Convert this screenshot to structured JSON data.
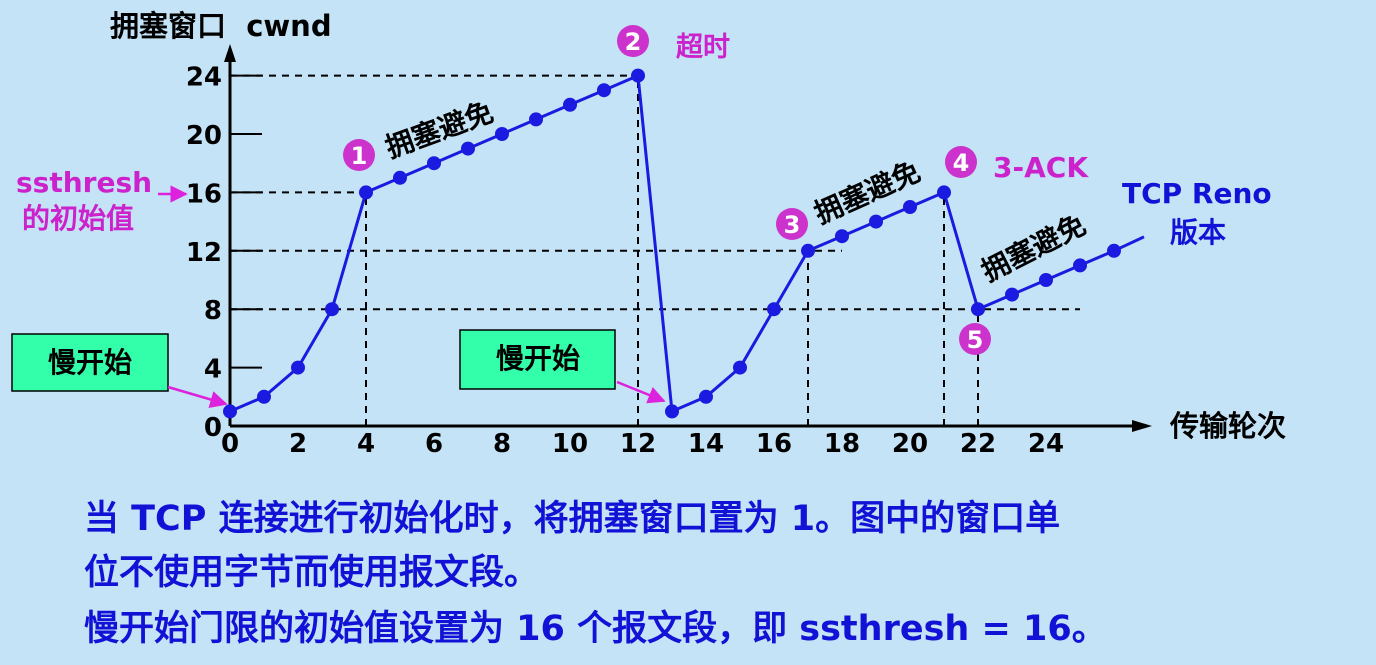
{
  "chart_data": {
    "type": "line",
    "title": "",
    "ylabel": "拥塞窗口  cwnd",
    "xlabel": "传输轮次",
    "x_ticks": [
      0,
      2,
      4,
      6,
      8,
      10,
      12,
      14,
      16,
      18,
      20,
      22,
      24
    ],
    "y_ticks": [
      0,
      4,
      8,
      12,
      16,
      20,
      24
    ],
    "xlim": [
      0,
      27
    ],
    "ylim": [
      0,
      26
    ],
    "series": [
      {
        "name": "",
        "x": [
          0,
          1,
          2,
          3,
          4,
          5,
          6,
          7,
          8,
          9,
          10,
          11,
          12,
          13,
          14,
          15,
          16,
          17,
          18,
          19,
          20,
          21,
          22,
          23,
          24,
          25,
          26
        ],
        "y": [
          1,
          2,
          4,
          8,
          16,
          17,
          18,
          19,
          20,
          21,
          22,
          23,
          24,
          1,
          2,
          4,
          8,
          12,
          13,
          14,
          15,
          16,
          8,
          9,
          10,
          11,
          12
        ]
      }
    ],
    "guide_lines": [
      {
        "axis": "y",
        "value": 24,
        "x_end": 12
      },
      {
        "axis": "y",
        "value": 16,
        "x_end": 4
      },
      {
        "axis": "y",
        "value": 12,
        "x_end": 18
      },
      {
        "axis": "y",
        "value": 8,
        "x_end": 25
      },
      {
        "axis": "x",
        "value": 4,
        "y_top": 16
      },
      {
        "axis": "x",
        "value": 12,
        "y_top": 24
      },
      {
        "axis": "x",
        "value": 17,
        "y_top": 12
      },
      {
        "axis": "x",
        "value": 21,
        "y_top": 16
      },
      {
        "axis": "x",
        "value": 22,
        "y_top": 8
      }
    ],
    "annotations": {
      "slow_start_label": "慢开始",
      "congestion_avoidance_label": "拥塞避免",
      "timeout_label": "超时",
      "three_ack_label": "3-ACK",
      "ssthresh_line1": "ssthresh",
      "ssthresh_line2": "的初始值",
      "version_line1": "TCP Reno",
      "version_line2": "版本",
      "markers": [
        "1",
        "2",
        "3",
        "4",
        "5"
      ]
    },
    "colors": {
      "background": "#c5e3f6",
      "line": "#1a1ae0",
      "marker_fill": "#cc33cc",
      "annotation_magenta": "#cc22cc",
      "label_box": "#33ffaa",
      "caption_text": "#1212d6"
    }
  },
  "caption": {
    "line1": "当 TCP 连接进行初始化时，将拥塞窗口置为 1。图中的窗口单",
    "line2": "位不使用字节而使用报文段。",
    "line3": "慢开始门限的初始值设置为 16 个报文段，即 ssthresh = 16。"
  }
}
